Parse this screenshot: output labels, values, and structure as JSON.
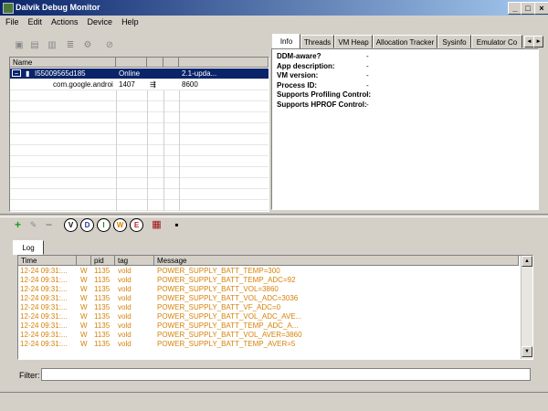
{
  "window": {
    "title": "Dalvik Debug Monitor",
    "controls": [
      "_",
      "□",
      "×"
    ]
  },
  "menu": [
    "File",
    "Edit",
    "Actions",
    "Device",
    "Help"
  ],
  "devices": {
    "columns": [
      "Name",
      "",
      "",
      "",
      ""
    ],
    "rows": [
      {
        "expander": "−",
        "name": "I55009565d185",
        "status": "Online",
        "c3": "",
        "c4": "",
        "target": "2.1-upda...",
        "selected": true
      },
      {
        "expander": "",
        "name": "com.google.androi",
        "status": "1407",
        "c3": "⇶",
        "c4": "",
        "target": "8600",
        "selected": false
      }
    ]
  },
  "tabs": [
    "Info",
    "Threads",
    "VM Heap",
    "Allocation Tracker",
    "Sysinfo",
    "Emulator Co"
  ],
  "info": [
    {
      "key": "DDM-aware?",
      "value": "-"
    },
    {
      "key": "App description:",
      "value": "-"
    },
    {
      "key": "VM version:",
      "value": "-"
    },
    {
      "key": "Process ID:",
      "value": "-"
    },
    {
      "key": "Supports Profiling Control:",
      "value": "-"
    },
    {
      "key": "Supports HPROF Control:",
      "value": "-"
    }
  ],
  "log_toolbar": {
    "add": "+",
    "edit": "✎",
    "remove": "−",
    "levels": [
      "V",
      "D",
      "I",
      "W",
      "E"
    ]
  },
  "log": {
    "tab": "Log",
    "columns": [
      "Time",
      "",
      "pid",
      "tag",
      "Message"
    ],
    "rows": [
      {
        "time": "12-24 09:31:...",
        "level": "W",
        "pid": "1135",
        "tag": "vold",
        "message": "POWER_SUPPLY_BATT_TEMP=300"
      },
      {
        "time": "12-24 09:31:...",
        "level": "W",
        "pid": "1135",
        "tag": "vold",
        "message": "POWER_SUPPLY_BATT_TEMP_ADC=92"
      },
      {
        "time": "12-24 09:31:...",
        "level": "W",
        "pid": "1135",
        "tag": "vold",
        "message": "POWER_SUPPLY_BATT_VOL=3860"
      },
      {
        "time": "12-24 09:31:...",
        "level": "W",
        "pid": "1135",
        "tag": "vold",
        "message": "POWER_SUPPLY_BATT_VOL_ADC=3036"
      },
      {
        "time": "12-24 09:31:...",
        "level": "W",
        "pid": "1135",
        "tag": "vold",
        "message": "POWER_SUPPLY_BATT_VF_ADC=0"
      },
      {
        "time": "12-24 09:31:...",
        "level": "W",
        "pid": "1135",
        "tag": "vold",
        "message": "POWER_SUPPLY_BATT_VOL_ADC_AVE..."
      },
      {
        "time": "12-24 09:31:...",
        "level": "W",
        "pid": "1135",
        "tag": "vold",
        "message": "POWER_SUPPLY_BATT_TEMP_ADC_A..."
      },
      {
        "time": "12-24 09:31:...",
        "level": "W",
        "pid": "1135",
        "tag": "vold",
        "message": "POWER_SUPPLY_BATT_VOL_AVER=3860"
      },
      {
        "time": "12-24 09:31:...",
        "level": "W",
        "pid": "1135",
        "tag": "vold",
        "message": "POWER_SUPPLY_BATT_TEMP_AVER=5"
      }
    ]
  },
  "filter": {
    "label": "Filter:",
    "value": ""
  },
  "colors": {
    "log_text": "#d7820a",
    "selection": "#0a246a",
    "title_start": "#0a246a",
    "title_end": "#a6caf0"
  }
}
